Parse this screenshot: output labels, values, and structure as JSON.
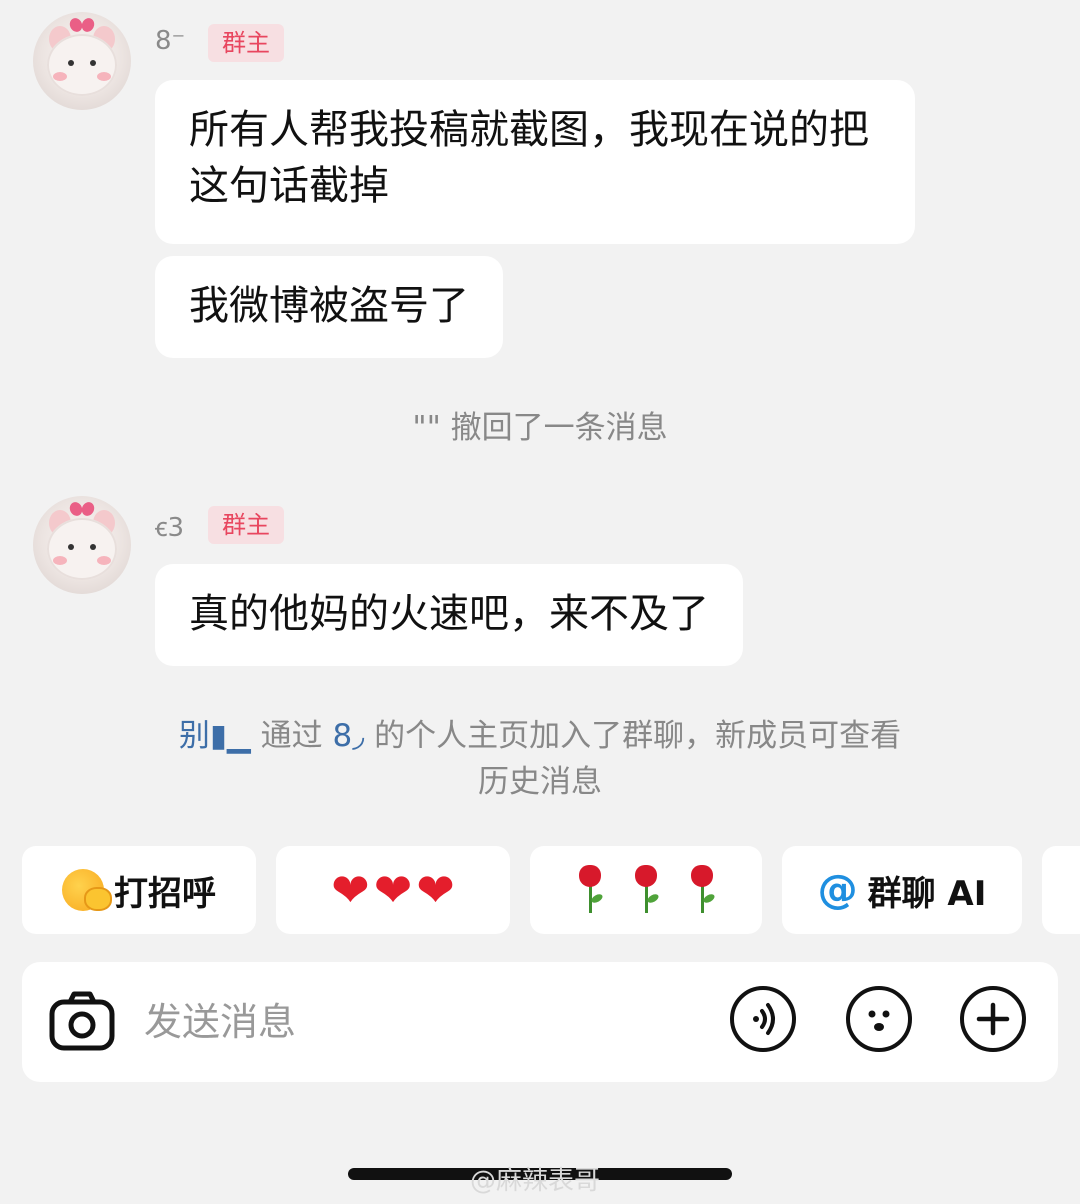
{
  "messages": [
    {
      "sender": "8⁻",
      "role_badge": "群主",
      "bubbles": [
        "所有人帮我投稿就截图，我现在说的把这句话截掉",
        "我微博被盗号了"
      ]
    },
    {
      "sender": "ꞓ3",
      "role_badge": "群主",
      "bubbles": [
        "真的他妈的火速吧，来不及了"
      ]
    }
  ],
  "system": {
    "recall": "\"\" 撤回了一条消息",
    "join_user": "别▮▁",
    "join_text_pre": " 通过 ",
    "join_owner": "8◞",
    "join_text_post": " 的个人主页加入了群聊，新成员可查看",
    "join_text_line2": "历史消息"
  },
  "quick_replies": [
    {
      "label": "打招呼",
      "icon": "wave-face-emoji"
    },
    {
      "label": "",
      "icon": "three-hearts"
    },
    {
      "label": "",
      "icon": "three-roses"
    },
    {
      "label": "群聊 AI",
      "icon": "at-icon"
    }
  ],
  "input": {
    "placeholder": "发送消息"
  },
  "watermark": "@麻辣表哥"
}
